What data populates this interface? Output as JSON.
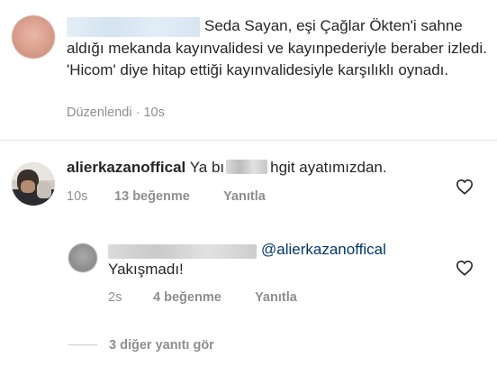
{
  "caption": {
    "text": "Seda Sayan, eşi Çağlar Ökten'i sahne aldığı mekanda kayınvalidesi ve kayınpederiyle beraber izledi. 'Hicom' diye hitap ettiği kayınvalidesiyle karşılıklı oynadı.",
    "edited_label": "Düzenlendi",
    "separator": "·",
    "time": "10s"
  },
  "comments": [
    {
      "username": "alierkazanoffical",
      "text_before": "Ya bı",
      "text_after": "hgit ayatımızdan.",
      "time": "10s",
      "likes": "13 beğenme",
      "reply_label": "Yanıtla"
    }
  ],
  "reply": {
    "mention": "@alierkazanoffical",
    "text": "Yakışmadı!",
    "time": "2s",
    "likes": "4 beğenme",
    "reply_label": "Yanıtla"
  },
  "view_replies": {
    "label": "3 diğer yanıtı gör"
  },
  "icons": {
    "like": "heart-outline-icon"
  },
  "colors": {
    "text": "#262626",
    "secondary": "#8e8e8e",
    "mention": "#00376b"
  }
}
